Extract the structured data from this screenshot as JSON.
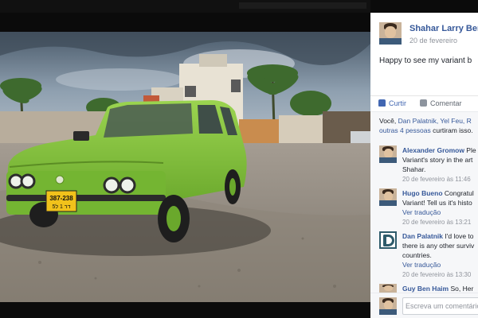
{
  "post": {
    "poster_name": "Shahar Larry Ben",
    "date": "20 de fevereiro",
    "caption": "Happy to see my variant b"
  },
  "actions": {
    "like_label": "Curtir",
    "comment_label": "Comentar"
  },
  "likes": {
    "line1_prefix": "Você, ",
    "line1_names": "Dan Palatnik, Yel Feu, R",
    "line2_link": "outras 4 pessoas",
    "line2_suffix": " curtiram isso."
  },
  "comments": [
    {
      "name": "Alexander Gromow",
      "first_text": " Ple",
      "lines": [
        "Variant's story in the art",
        "Shahar."
      ],
      "time": "20 de fevereiro às 11:46"
    },
    {
      "name": "Hugo Bueno",
      "first_text": " Congratul",
      "lines": [
        "Variant! Tell us it's histo"
      ],
      "link": "Ver tradução",
      "time": "20 de fevereiro às 13:21"
    },
    {
      "name": "Dan Palatnik",
      "first_text": " I'd love to",
      "lines": [
        "there is any other surviv",
        "countries."
      ],
      "link": "Ver tradução",
      "time": "20 de fevereiro às 13:30"
    },
    {
      "name": "Guy Ben Haim",
      "first_text": " So, Her"
    }
  ],
  "compose": {
    "placeholder": "Escreva um comentário"
  },
  "photo": {
    "license_plate": "387-238",
    "plate_sub": "דר 1 ל5",
    "car_color": "#7cbf3a"
  }
}
